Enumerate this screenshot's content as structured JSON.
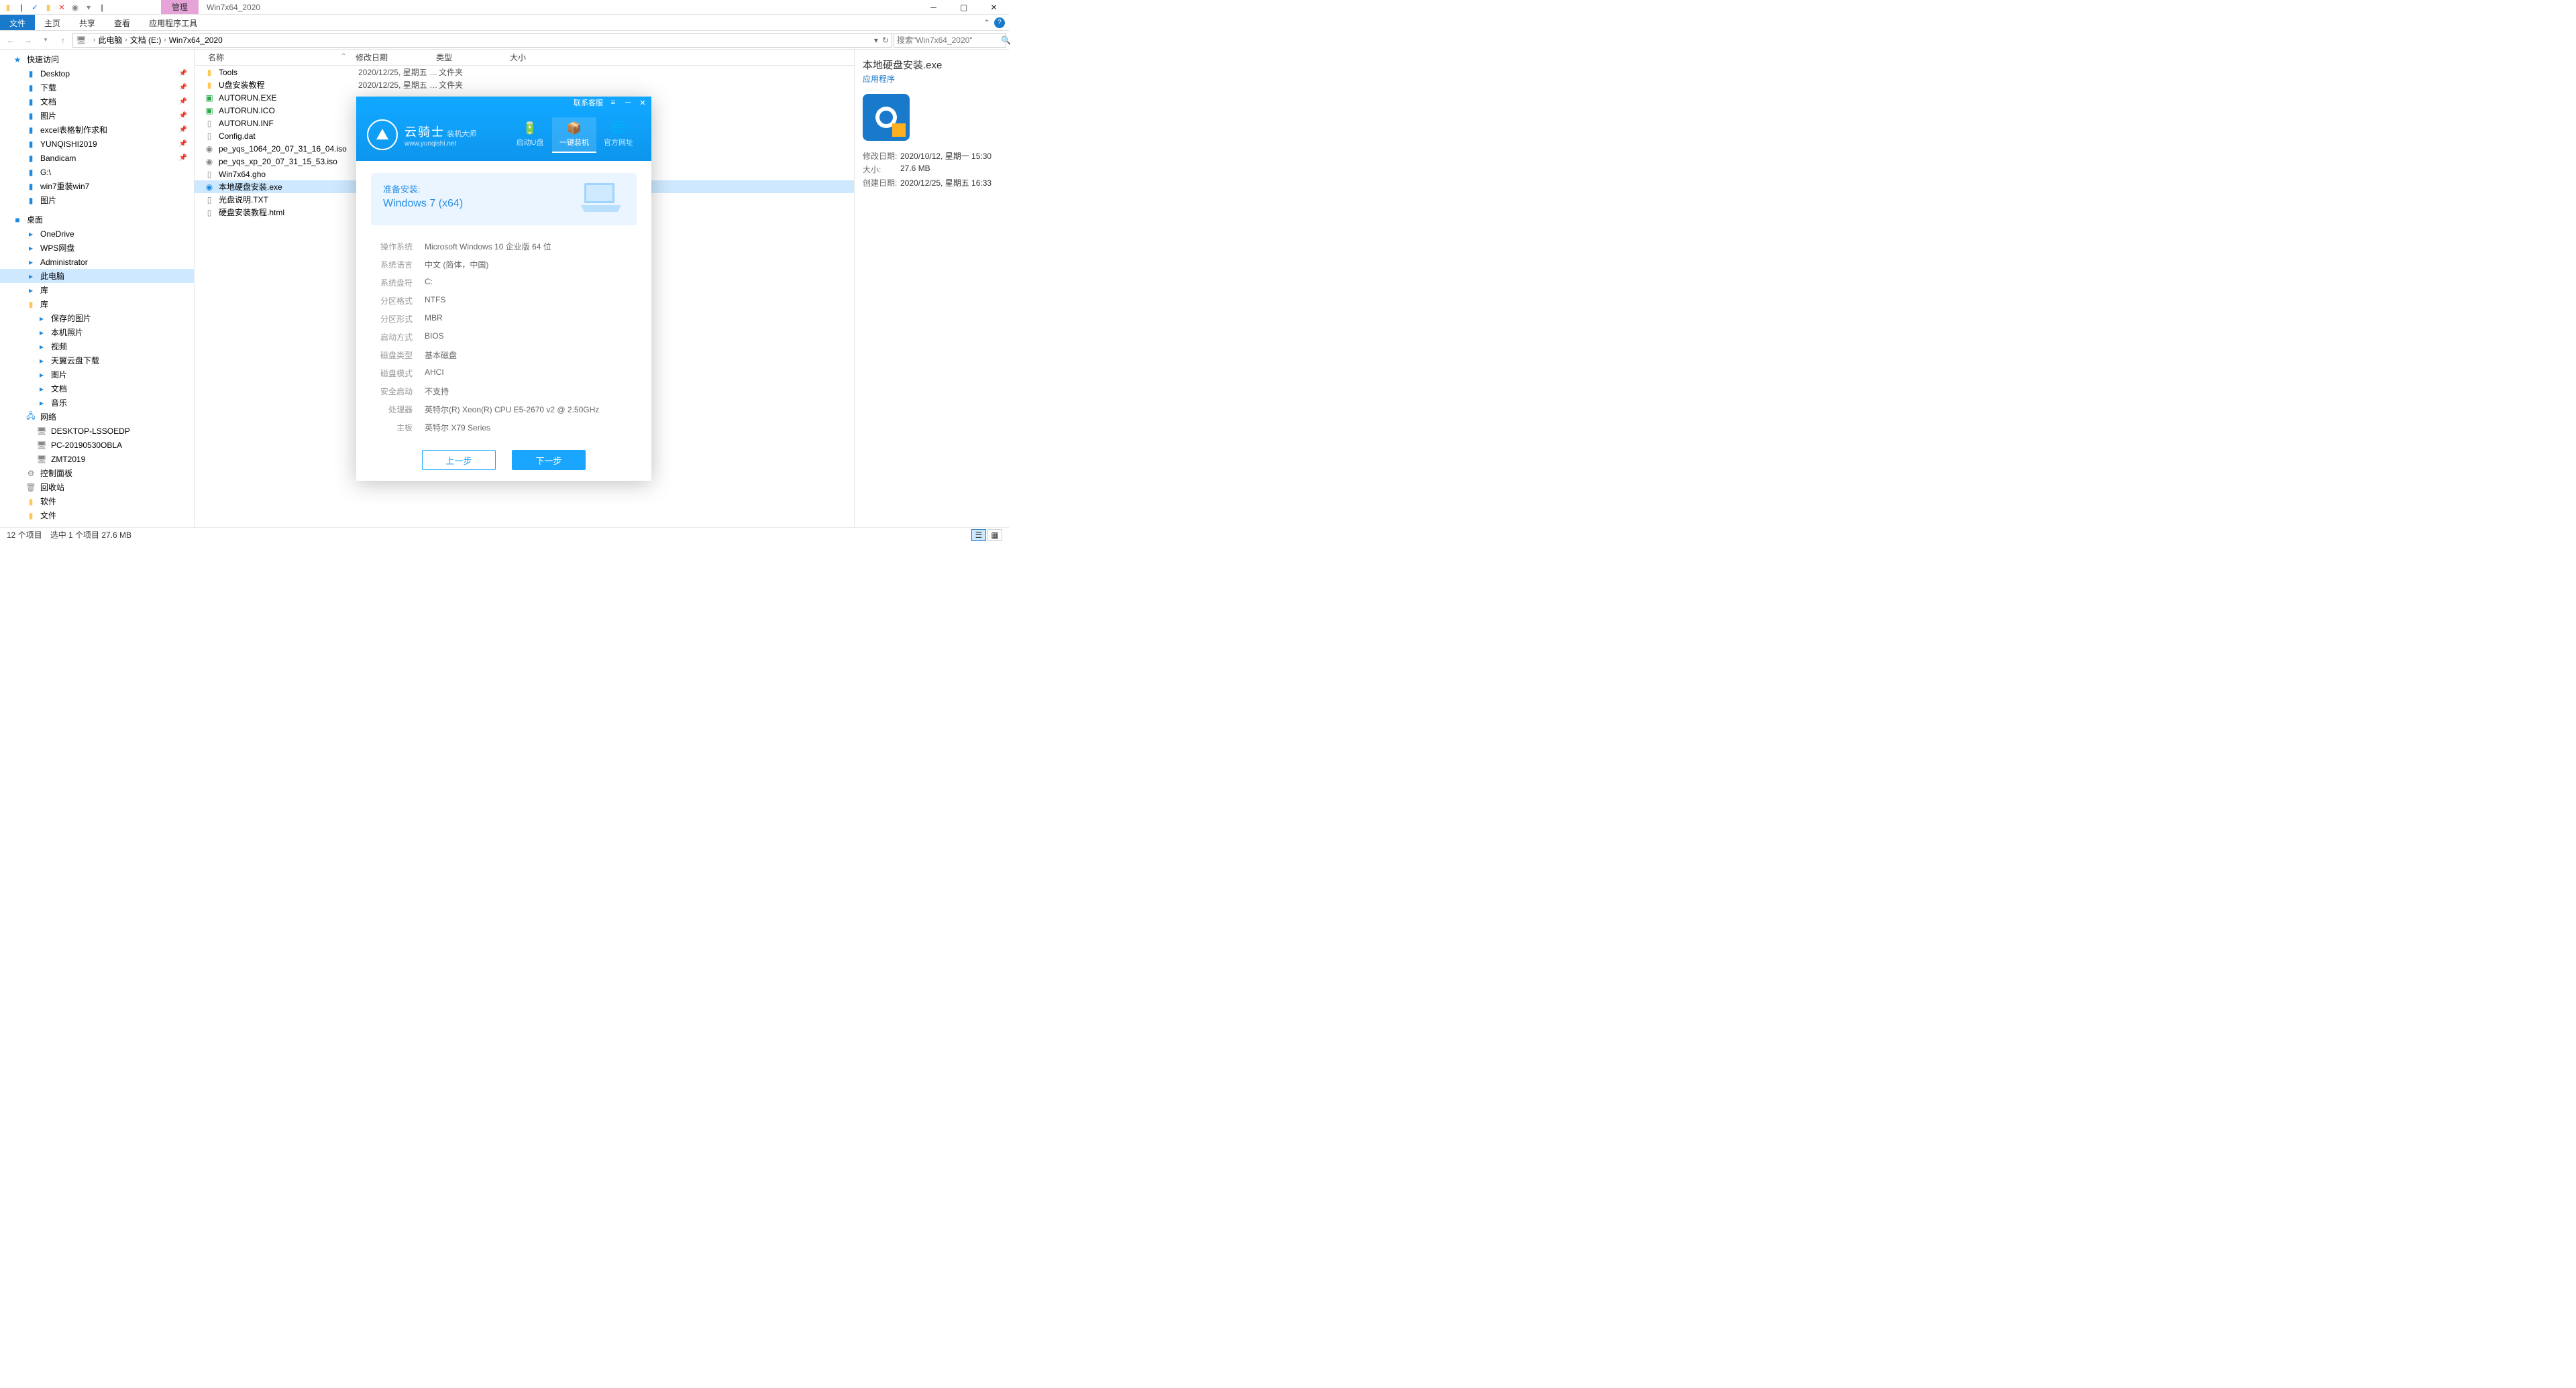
{
  "titlebar": {
    "contextual_tab": "管理",
    "title": "Win7x64_2020"
  },
  "ribbon": {
    "file": "文件",
    "tabs": [
      "主页",
      "共享",
      "查看",
      "应用程序工具"
    ]
  },
  "nav": {
    "crumbs": [
      "此电脑",
      "文档 (E:)",
      "Win7x64_2020"
    ],
    "search_placeholder": "搜索\"Win7x64_2020\""
  },
  "sidebar": {
    "quick": "快速访问",
    "quick_items": [
      {
        "label": "Desktop",
        "pin": true
      },
      {
        "label": "下载",
        "pin": true
      },
      {
        "label": "文档",
        "pin": true
      },
      {
        "label": "图片",
        "pin": true
      },
      {
        "label": "excel表格制作求和",
        "pin": true
      },
      {
        "label": "YUNQISHI2019",
        "pin": true
      },
      {
        "label": "Bandicam",
        "pin": true
      },
      {
        "label": "G:\\",
        "pin": false
      },
      {
        "label": "win7重装win7",
        "pin": false
      },
      {
        "label": "图片",
        "pin": false
      }
    ],
    "desktop": "桌面",
    "desktop_items": [
      "OneDrive",
      "WPS网盘",
      "Administrator",
      "此电脑",
      "库"
    ],
    "lib_items": [
      "保存的图片",
      "本机照片",
      "视频",
      "天翼云盘下载",
      "图片",
      "文档",
      "音乐"
    ],
    "net": "网络",
    "net_items": [
      "DESKTOP-LSSOEDP",
      "PC-20190530OBLA",
      "ZMT2019"
    ],
    "ctrl": "控制面板",
    "recycle": "回收站",
    "soft": "软件",
    "docs": "文件"
  },
  "columns": {
    "name": "名称",
    "date": "修改日期",
    "type": "类型",
    "size": "大小"
  },
  "files": [
    {
      "icon": "folder",
      "name": "Tools",
      "date": "2020/12/25, 星期五 1...",
      "type": "文件夹"
    },
    {
      "icon": "folder",
      "name": "U盘安装教程",
      "date": "2020/12/25, 星期五 1...",
      "type": "文件夹"
    },
    {
      "icon": "exe-g",
      "name": "AUTORUN.EXE",
      "date": "",
      "type": ""
    },
    {
      "icon": "exe-g",
      "name": "AUTORUN.ICO",
      "date": "",
      "type": ""
    },
    {
      "icon": "file",
      "name": "AUTORUN.INF",
      "date": "",
      "type": ""
    },
    {
      "icon": "file",
      "name": "Config.dat",
      "date": "",
      "type": ""
    },
    {
      "icon": "disc",
      "name": "pe_yqs_1064_20_07_31_16_04.iso",
      "date": "",
      "type": ""
    },
    {
      "icon": "disc",
      "name": "pe_yqs_xp_20_07_31_15_53.iso",
      "date": "",
      "type": ""
    },
    {
      "icon": "file",
      "name": "Win7x64.gho",
      "date": "",
      "type": ""
    },
    {
      "icon": "exe-b",
      "name": "本地硬盘安装.exe",
      "date": "",
      "type": "",
      "selected": true
    },
    {
      "icon": "txt",
      "name": "光盘说明.TXT",
      "date": "",
      "type": ""
    },
    {
      "icon": "file",
      "name": "硬盘安装教程.html",
      "date": "",
      "type": ""
    }
  ],
  "details": {
    "title": "本地硬盘安装.exe",
    "sub": "应用程序",
    "rows": [
      {
        "label": "修改日期:",
        "val": "2020/10/12, 星期一 15:30"
      },
      {
        "label": "大小:",
        "val": "27.6 MB"
      },
      {
        "label": "创建日期:",
        "val": "2020/12/25, 星期五 16:33"
      }
    ]
  },
  "status": {
    "count": "12 个项目",
    "sel": "选中 1 个项目  27.6 MB"
  },
  "dialog": {
    "contact": "联系客服",
    "brand_cn": "云骑士",
    "brand_sub": "装机大师",
    "brand_en": "www.yunqishi.net",
    "nav": [
      {
        "label": "启动U盘"
      },
      {
        "label": "一键装机",
        "active": true
      },
      {
        "label": "官方网址"
      }
    ],
    "banner_t1": "准备安装:",
    "banner_t2": "Windows 7 (x64)",
    "info": [
      {
        "label": "操作系统",
        "val": "Microsoft Windows 10 企业版 64 位"
      },
      {
        "label": "系统语言",
        "val": "中文 (简体，中国)"
      },
      {
        "label": "系统盘符",
        "val": "C:"
      },
      {
        "label": "分区格式",
        "val": "NTFS"
      },
      {
        "label": "分区形式",
        "val": "MBR"
      },
      {
        "label": "启动方式",
        "val": "BIOS"
      },
      {
        "label": "磁盘类型",
        "val": "基本磁盘"
      },
      {
        "label": "磁盘模式",
        "val": "AHCI"
      },
      {
        "label": "安全启动",
        "val": "不支持"
      },
      {
        "label": "处理器",
        "val": "英特尔(R) Xeon(R) CPU E5-2670 v2 @ 2.50GHz"
      },
      {
        "label": "主板",
        "val": "英特尔 X79 Series"
      }
    ],
    "prev": "上一步",
    "next": "下一步"
  }
}
